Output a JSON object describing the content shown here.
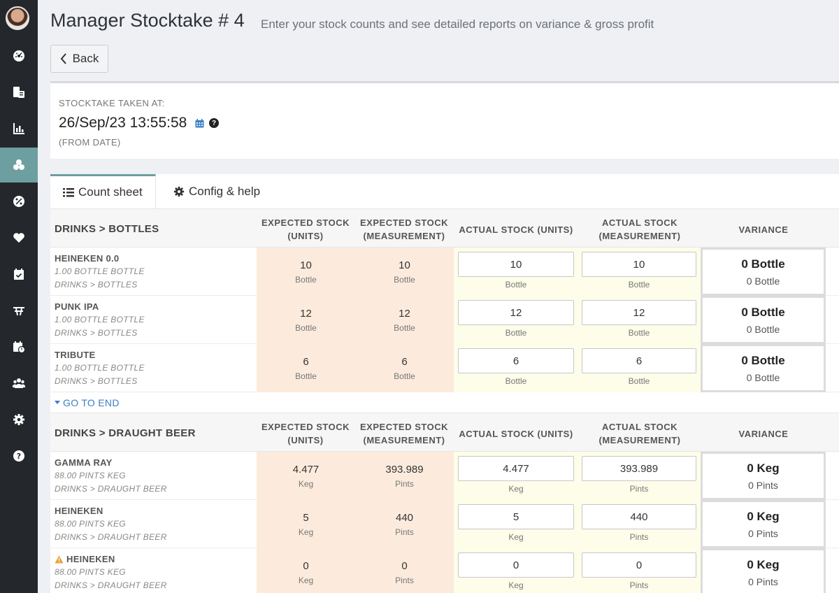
{
  "sidebar": {
    "items": [
      {
        "icon": "dashboard-icon"
      },
      {
        "icon": "tills-icon"
      },
      {
        "icon": "reports-chart-icon"
      },
      {
        "icon": "stock-boxes-icon",
        "active": true
      },
      {
        "icon": "discount-icon"
      },
      {
        "icon": "heart-icon"
      },
      {
        "icon": "calendar-check-icon"
      },
      {
        "icon": "table-icon"
      },
      {
        "icon": "calendar-clock-icon"
      },
      {
        "icon": "users-icon"
      },
      {
        "icon": "gear-icon"
      },
      {
        "icon": "question-icon"
      }
    ]
  },
  "header": {
    "title": "Manager Stocktake # 4",
    "subtitle": "Enter your stock counts and see detailed reports on variance & gross profit",
    "back_label": "Back"
  },
  "stocktake": {
    "taken_at_label": "STOCKTAKE TAKEN AT:",
    "taken_at_value": "26/Sep/23 13:55:58",
    "from_label": "(FROM DATE)"
  },
  "tabs": [
    {
      "label": "Count sheet",
      "active": true
    },
    {
      "label": "Config & help",
      "active": false
    }
  ],
  "columns": {
    "expected_units": [
      "EXPECTED STOCK",
      "(UNITS)"
    ],
    "expected_measurement": [
      "EXPECTED STOCK",
      "(MEASUREMENT)"
    ],
    "actual_units": "ACTUAL STOCK (UNITS)",
    "actual_measurement": [
      "ACTUAL STOCK",
      "(MEASUREMENT)"
    ],
    "variance": "VARIANCE"
  },
  "go_to_end_label": "GO TO END",
  "sections": [
    {
      "title": "DRINKS > BOTTLES",
      "rows": [
        {
          "name": "HEINEKEN 0.0",
          "size": "1.00 BOTTLE BOTTLE",
          "category": "DRINKS > BOTTLES",
          "warning": false,
          "exp_units": "10",
          "exp_units_unit": "Bottle",
          "exp_meas": "10",
          "exp_meas_unit": "Bottle",
          "act_units": "10",
          "act_units_unit": "Bottle",
          "act_meas": "10",
          "act_meas_unit": "Bottle",
          "var_main": "0 Bottle",
          "var_sub": "0 Bottle"
        },
        {
          "name": "PUNK IPA",
          "size": "1.00 BOTTLE BOTTLE",
          "category": "DRINKS > BOTTLES",
          "warning": false,
          "exp_units": "12",
          "exp_units_unit": "Bottle",
          "exp_meas": "12",
          "exp_meas_unit": "Bottle",
          "act_units": "12",
          "act_units_unit": "Bottle",
          "act_meas": "12",
          "act_meas_unit": "Bottle",
          "var_main": "0 Bottle",
          "var_sub": "0 Bottle"
        },
        {
          "name": "TRIBUTE",
          "size": "1.00 BOTTLE BOTTLE",
          "category": "DRINKS > BOTTLES",
          "warning": false,
          "exp_units": "6",
          "exp_units_unit": "Bottle",
          "exp_meas": "6",
          "exp_meas_unit": "Bottle",
          "act_units": "6",
          "act_units_unit": "Bottle",
          "act_meas": "6",
          "act_meas_unit": "Bottle",
          "var_main": "0 Bottle",
          "var_sub": "0 Bottle"
        }
      ]
    },
    {
      "title": "DRINKS > DRAUGHT BEER",
      "rows": [
        {
          "name": "GAMMA RAY",
          "size": "88.00 PINTS KEG",
          "category": "DRINKS > DRAUGHT BEER",
          "warning": false,
          "exp_units": "4.477",
          "exp_units_unit": "Keg",
          "exp_meas": "393.989",
          "exp_meas_unit": "Pints",
          "act_units": "4.477",
          "act_units_unit": "Keg",
          "act_meas": "393.989",
          "act_meas_unit": "Pints",
          "var_main": "0 Keg",
          "var_sub": "0 Pints"
        },
        {
          "name": "HEINEKEN",
          "size": "88.00 PINTS KEG",
          "category": "DRINKS > DRAUGHT BEER",
          "warning": false,
          "exp_units": "5",
          "exp_units_unit": "Keg",
          "exp_meas": "440",
          "exp_meas_unit": "Pints",
          "act_units": "5",
          "act_units_unit": "Keg",
          "act_meas": "440",
          "act_meas_unit": "Pints",
          "var_main": "0 Keg",
          "var_sub": "0 Pints"
        },
        {
          "name": "HEINEKEN",
          "size": "88.00 PINTS KEG",
          "category": "DRINKS > DRAUGHT BEER",
          "warning": true,
          "exp_units": "0",
          "exp_units_unit": "Keg",
          "exp_meas": "0",
          "exp_meas_unit": "Pints",
          "act_units": "0",
          "act_units_unit": "Keg",
          "act_meas": "0",
          "act_meas_unit": "Pints",
          "var_main": "0 Keg",
          "var_sub": "0 Pints"
        }
      ]
    }
  ],
  "colors": {
    "sidebar_bg": "#24282d",
    "accent": "#6d9fa0",
    "expected_bg": "#fcebdd",
    "actual_bg": "#fdfde9",
    "link": "#3a7fc2",
    "warning": "#e8a13a"
  }
}
